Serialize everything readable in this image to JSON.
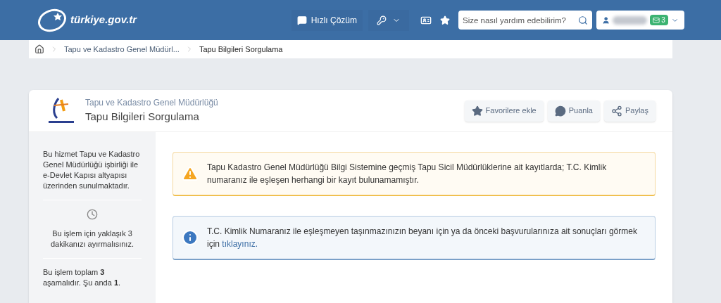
{
  "header": {
    "logo_text": "türkiye.gov.tr",
    "quick_solution": "Hızlı Çözüm",
    "search": {
      "placeholder": "Size nasıl yardım edebilirim?"
    },
    "user": {
      "message_count": "3"
    }
  },
  "breadcrumb": [
    {
      "label": "Tapu ve Kadastro Genel Müdürl..."
    },
    {
      "label": "Tapu Bilgileri Sorgulama"
    }
  ],
  "service": {
    "institution": "Tapu ve Kadastro Genel Müdürlüğü",
    "title": "Tapu Bilgileri Sorgulama",
    "actions": [
      {
        "kind": "favorite",
        "label": "Favorilere ekle"
      },
      {
        "kind": "rate",
        "label": "Puanla"
      },
      {
        "kind": "share",
        "label": "Paylaş"
      }
    ]
  },
  "sidebar": [
    {
      "kind": "text",
      "text": "Bu hizmet Tapu ve Kadastro Genel Müdürlüğü işbirliği ile e-Devlet Kapısı altyapısı üzerinden sunulmaktadır."
    },
    {
      "kind": "time",
      "text": "Bu işlem için yaklaşık 3 dakikanızı ayırmalısınız."
    },
    {
      "kind": "steps",
      "text": "Bu işlem toplam **3** aşamalıdır. Şu anda **1**."
    }
  ],
  "alerts": [
    {
      "kind": "warning",
      "text": "Tapu Kadastro Genel Müdürlüğü Bilgi Sistemine geçmiş Tapu Sicil Müdürlüklerine ait kayıtlarda; T.C. Kimlik numaranız ile eşleşen herhangi bir kayıt bulunamamıştır."
    },
    {
      "kind": "info",
      "text": "T.C. Kimlik Numaranız ile eşleşmeyen taşınmazınızın beyanı için ya da önceki başvurularınıza ait sonuçları görmek için",
      "link": "tıklayınız."
    }
  ]
}
